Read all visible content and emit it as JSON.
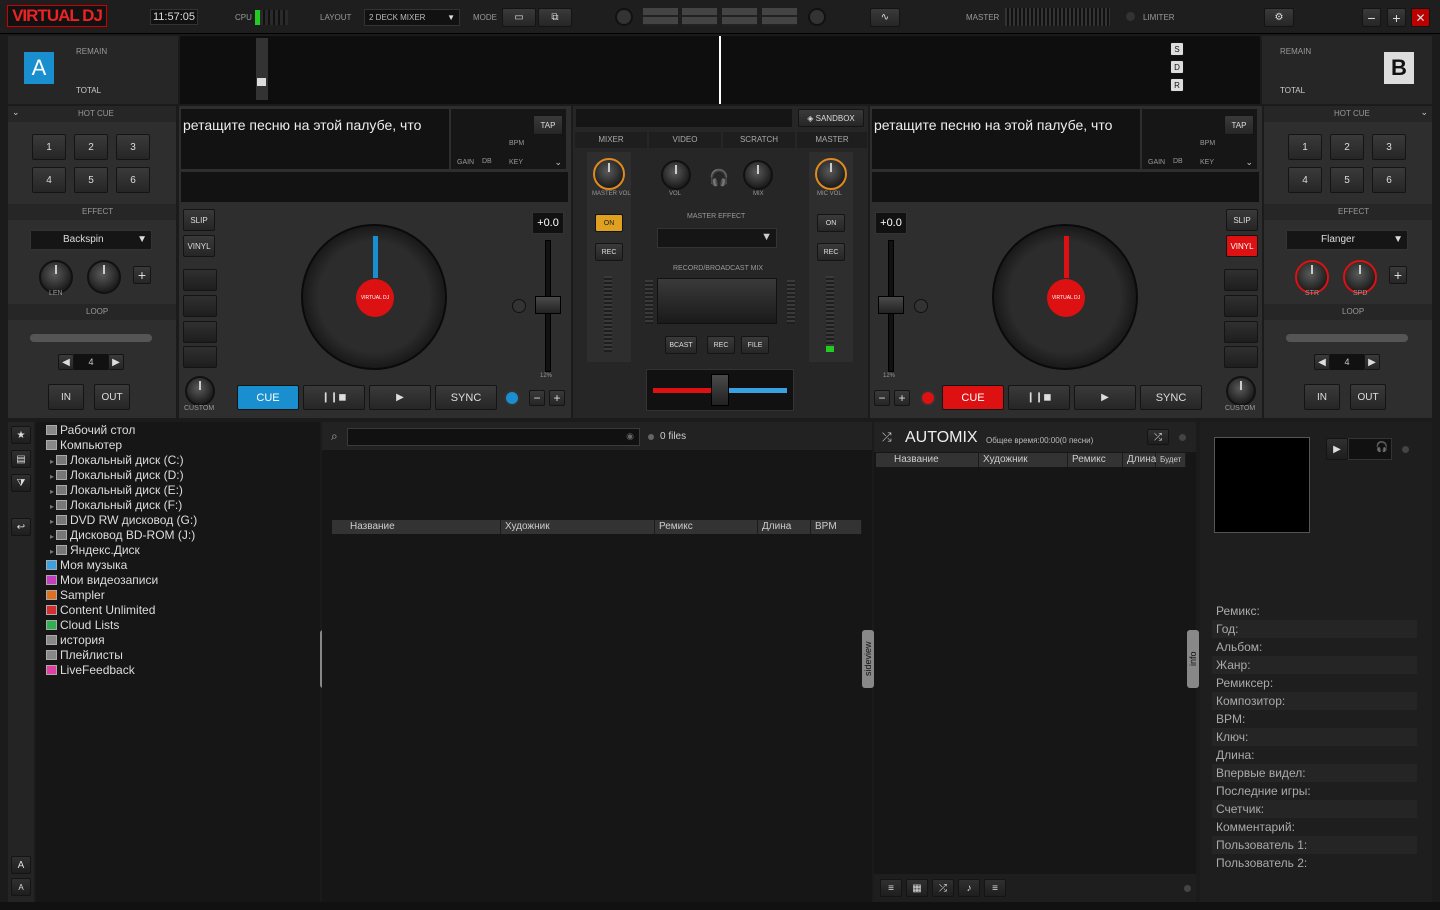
{
  "topbar": {
    "logo": "VIRTUAL DJ",
    "clock": "11:57:05",
    "cpu_label": "CPU",
    "layout_label": "LAYOUT",
    "layout_value": "2 DECK MIXER",
    "mode_label": "MODE",
    "master_label": "MASTER",
    "limiter_label": "LIMITER"
  },
  "deck_a": {
    "letter": "A",
    "remain": "REMAIN",
    "total": "TOTAL",
    "hotcue": "HOT CUE",
    "cues": [
      "1",
      "2",
      "3",
      "4",
      "5",
      "6"
    ],
    "effect": "EFFECT",
    "effect_name": "Backspin",
    "knob1": "LEN",
    "loop": "LOOP",
    "loop_size": "4",
    "in": "IN",
    "out": "OUT",
    "drop_text": "ретащите песню на этой палубе, что",
    "tap": "TAP",
    "bpm": "BPM",
    "gain": "GAIN",
    "db": "dB",
    "key": "KEY",
    "slip": "SLIP",
    "vinyl": "VINYL",
    "pitch": "+0.0",
    "pitch_range": "12%",
    "custom": "CUSTOM",
    "cue": "CUE",
    "play_pause": "❙❙◼",
    "play": "▶",
    "sync": "SYNC",
    "minus": "−",
    "plus": "+"
  },
  "deck_b": {
    "letter": "B",
    "remain": "REMAIN",
    "total": "TOTAL",
    "hotcue": "HOT CUE",
    "cues": [
      "1",
      "2",
      "3",
      "4",
      "5",
      "6"
    ],
    "effect": "EFFECT",
    "effect_name": "Flanger",
    "knob1": "STR",
    "knob2": "SPD",
    "loop": "LOOP",
    "loop_size": "4",
    "in": "IN",
    "out": "OUT",
    "drop_text": "ретащите песню на этой палубе, что",
    "tap": "TAP",
    "bpm": "BPM",
    "gain": "GAIN",
    "db": "dB",
    "key": "KEY",
    "slip": "SLIP",
    "vinyl": "VINYL",
    "pitch": "+0.0",
    "pitch_range": "12%",
    "custom": "CUSTOM",
    "cue": "CUE",
    "play_pause": "❙❙◼",
    "play": "▶",
    "sync": "SYNC",
    "minus": "−",
    "plus": "+"
  },
  "waveform": {
    "s": "S",
    "d": "D",
    "r": "R"
  },
  "mixer": {
    "sandbox": "SANDBOX",
    "tabs": [
      "MIXER",
      "VIDEO",
      "SCRATCH",
      "MASTER"
    ],
    "master_vol": "MASTER VOL",
    "vol": "VOL",
    "mix": "MIX",
    "mic_vol": "MIC VOL",
    "on": "ON",
    "rec": "REC",
    "master_effect": "MASTER EFFECT",
    "record_broadcast": "RECORD/BROADCAST MIX",
    "bcast": "BCAST",
    "rec2": "REC",
    "file": "FILE"
  },
  "browser": {
    "tree": [
      {
        "label": "Рабочий стол",
        "level": 0,
        "color": "#888"
      },
      {
        "label": "Компьютер",
        "level": 0,
        "color": "#888"
      },
      {
        "label": "Локальный диск (C:)",
        "level": 1,
        "color": "#777"
      },
      {
        "label": "Локальный диск (D:)",
        "level": 1,
        "color": "#777"
      },
      {
        "label": "Локальный диск (E:)",
        "level": 1,
        "color": "#777"
      },
      {
        "label": "Локальный диск (F:)",
        "level": 1,
        "color": "#777"
      },
      {
        "label": "DVD RW дисковод (G:)",
        "level": 1,
        "color": "#777"
      },
      {
        "label": "Дисковод BD-ROM (J:)",
        "level": 1,
        "color": "#777"
      },
      {
        "label": "Яндекс.Диск",
        "level": 1,
        "color": "#777"
      },
      {
        "label": "Моя музыка",
        "level": 0,
        "color": "#3aa0e0"
      },
      {
        "label": "Мои видеозаписи",
        "level": 0,
        "color": "#c040c0"
      },
      {
        "label": "Sampler",
        "level": 0,
        "color": "#e07020"
      },
      {
        "label": "Content Unlimited",
        "level": 0,
        "color": "#d03030"
      },
      {
        "label": "Cloud Lists",
        "level": 0,
        "color": "#30b050"
      },
      {
        "label": "история",
        "level": 0,
        "color": "#888"
      },
      {
        "label": "Плейлисты",
        "level": 0,
        "color": "#888"
      },
      {
        "label": "LiveFeedback",
        "level": 0,
        "color": "#e040a0"
      }
    ],
    "folders_tab": "folders",
    "files_count": "0 files",
    "columns": [
      "Название",
      "Художник",
      "Ремикс",
      "Длина",
      "BPM"
    ],
    "sideview_tab": "sideview"
  },
  "automix": {
    "title": "AUTOMIX",
    "total_time": "Общее время:00:00(0 песни)",
    "columns": [
      "Название",
      "Художник",
      "Ремикс",
      "Длина",
      "Будет и"
    ]
  },
  "info": {
    "tab": "info",
    "fields": [
      "Ремикс:",
      "Год:",
      "Альбом:",
      "Жанр:",
      "Ремиксер:",
      "Композитор:",
      "BPM:",
      "Ключ:",
      "Длина:",
      "Впервые видел:",
      "Последние игры:",
      "Счетчик:",
      "Комментарий:",
      "Пользователь 1:",
      "Пользователь 2:"
    ]
  },
  "colors": {
    "blue": "#1a8fd0",
    "red": "#d11",
    "orange": "#e08a20"
  }
}
